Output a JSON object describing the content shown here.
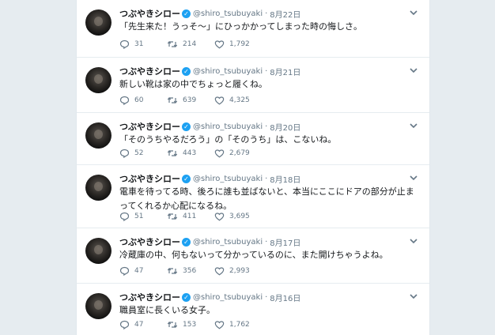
{
  "tweets": [
    {
      "name": "つぶやきシロー",
      "handle": "@shiro_tsubuyaki",
      "date": "8月22日",
      "text": "「先生来た！うっそ〜」にひっかかってしまった時の悔しさ。",
      "replies": "31",
      "retweets": "214",
      "likes": "1,792"
    },
    {
      "name": "つぶやきシロー",
      "handle": "@shiro_tsubuyaki",
      "date": "8月21日",
      "text": "新しい靴は家の中でちょっと履くね。",
      "replies": "60",
      "retweets": "639",
      "likes": "4,325"
    },
    {
      "name": "つぶやきシロー",
      "handle": "@shiro_tsubuyaki",
      "date": "8月20日",
      "text": "「そのうちやるだろう」の「そのうち」は、こないね。",
      "replies": "52",
      "retweets": "443",
      "likes": "2,679"
    },
    {
      "name": "つぶやきシロー",
      "handle": "@shiro_tsubuyaki",
      "date": "8月18日",
      "text": "電車を待ってる時、後ろに誰も並ばないと、本当にここにドアの部分が止まってくれるか心配になるね。",
      "replies": "51",
      "retweets": "411",
      "likes": "3,695"
    },
    {
      "name": "つぶやきシロー",
      "handle": "@shiro_tsubuyaki",
      "date": "8月17日",
      "text": "冷蔵庫の中、何もないって分かっているのに、また開けちゃうよね。",
      "replies": "47",
      "retweets": "356",
      "likes": "2,993"
    },
    {
      "name": "つぶやきシロー",
      "handle": "@shiro_tsubuyaki",
      "date": "8月16日",
      "text": "職員室に長くいる女子。",
      "replies": "47",
      "retweets": "153",
      "likes": "1,762"
    }
  ],
  "icons": {
    "reply": "reply-icon",
    "retweet": "retweet-icon",
    "like": "heart-icon",
    "verified": "verified-badge-icon",
    "caret": "chevron-down-icon"
  },
  "colors": {
    "page_bg": "#e6ecf0",
    "verified": "#1da1f2",
    "muted": "#657786",
    "text": "#14171a"
  }
}
